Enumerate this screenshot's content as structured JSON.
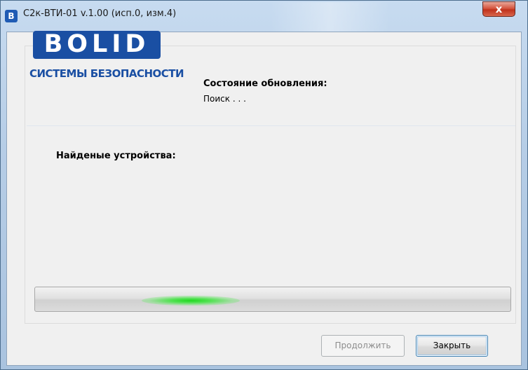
{
  "window": {
    "title": "С2к-ВТИ-01 v.1.00 (исп.0, изм.4)",
    "icon_letter": "В",
    "close_glyph": "x"
  },
  "logo": {
    "word": "BOLID",
    "subtitle": "СИСТЕМЫ БЕЗОПАСНОСТИ",
    "brand_color": "#1a4fa3"
  },
  "status": {
    "label": "Состояние обновления:",
    "value": "Поиск . . ."
  },
  "devices": {
    "label": "Найденые устройства:"
  },
  "progress": {
    "mode": "indeterminate",
    "glow_color": "#1fd81f"
  },
  "buttons": {
    "continue_label": "Продолжить",
    "continue_enabled": false,
    "close_label": "Закрыть"
  }
}
